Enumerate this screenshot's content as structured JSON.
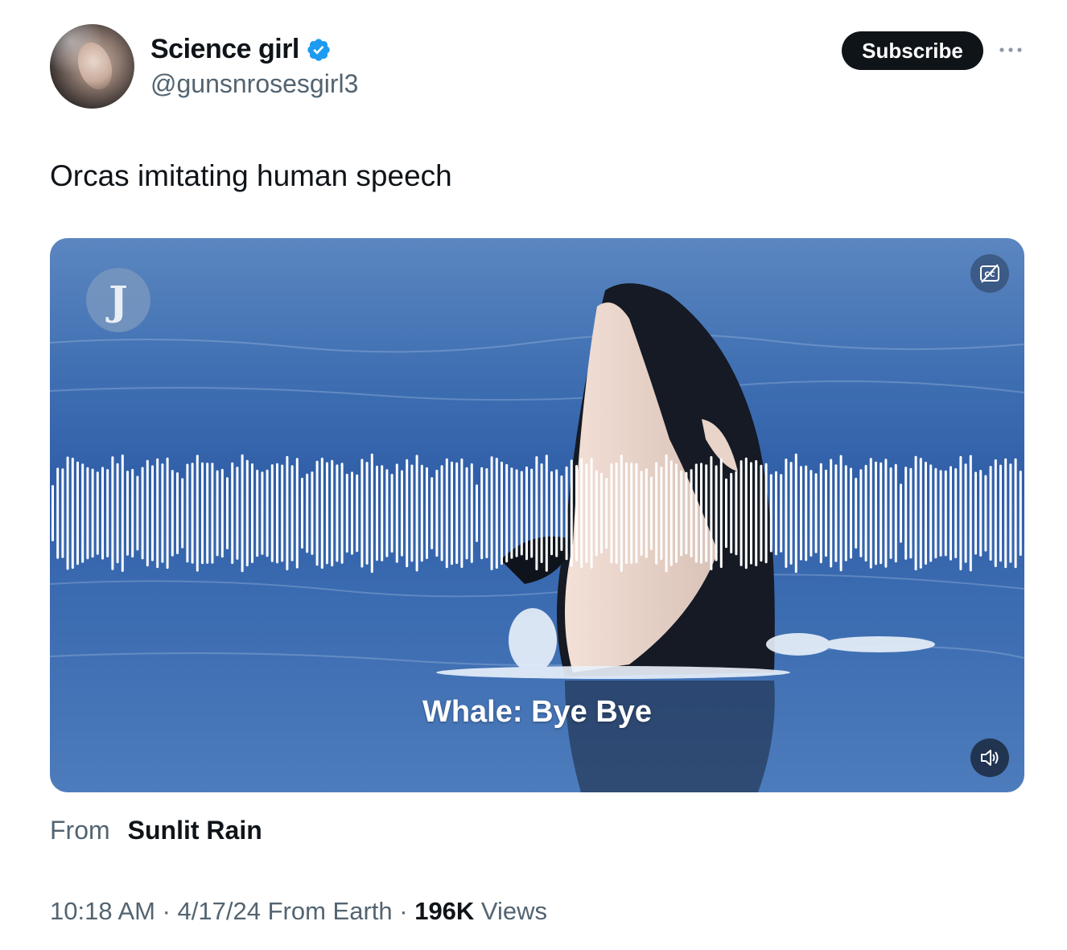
{
  "author": {
    "display_name": "Science girl",
    "handle": "@gunsnrosesgirl3",
    "verified_icon": "verified-badge-icon"
  },
  "actions": {
    "subscribe_label": "Subscribe",
    "more_icon": "more-horizontal-icon"
  },
  "tweet": {
    "text": "Orcas imitating human speech"
  },
  "media": {
    "logo_letter": "J",
    "caption": "Whale: Bye Bye",
    "cc_icon": "closed-captions-off-icon",
    "volume_icon": "volume-icon"
  },
  "attribution": {
    "from_label": "From",
    "source": "Sunlit Rain"
  },
  "meta": {
    "time": "10:18 AM",
    "sep1": " · ",
    "date": "4/17/24",
    "location": " From Earth",
    "sep2": " · ",
    "views_count": "196K",
    "views_label": " Views"
  },
  "colors": {
    "accent": "#1d9bf0",
    "text_primary": "#0f1419",
    "text_secondary": "#536471"
  }
}
